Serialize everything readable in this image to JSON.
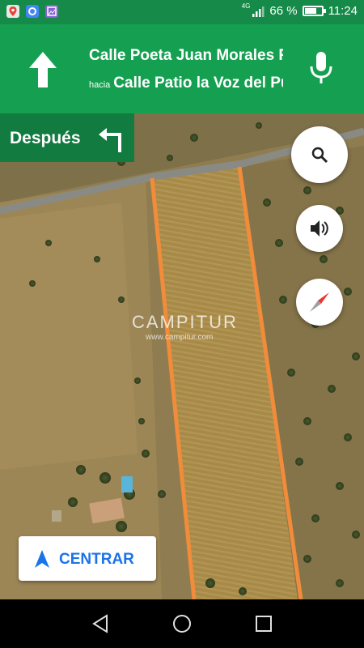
{
  "status_bar": {
    "network": "4G",
    "battery_percent": "66 %",
    "battery_level": 0.66,
    "time": "11:24",
    "notification_icons": [
      "maps-app-icon",
      "location-app-icon",
      "gallery-app-icon"
    ]
  },
  "navigation": {
    "direction_icon": "straight-arrow-icon",
    "current_street": "Calle Poeta Juan Morales Roj",
    "toward_prefix": "hacia",
    "toward_street": "Calle Patio la Voz del Puebl",
    "voice_icon": "mic-icon",
    "header_color": "#15a051"
  },
  "next_turn": {
    "label": "Después",
    "icon": "turn-left-icon",
    "color": "#127b3f"
  },
  "map": {
    "watermark": "CAMPITUR",
    "watermark_url": "www.campitur.com",
    "route_color": "#f08c3a"
  },
  "controls": {
    "search_icon": "search-icon",
    "sound_icon": "volume-icon",
    "compass_icon": "compass-icon",
    "recenter_label": "CENTRAR",
    "recenter_icon": "navigation-arrow-icon"
  },
  "system_nav": {
    "back": "back-icon",
    "home": "home-icon",
    "recents": "recents-icon"
  }
}
